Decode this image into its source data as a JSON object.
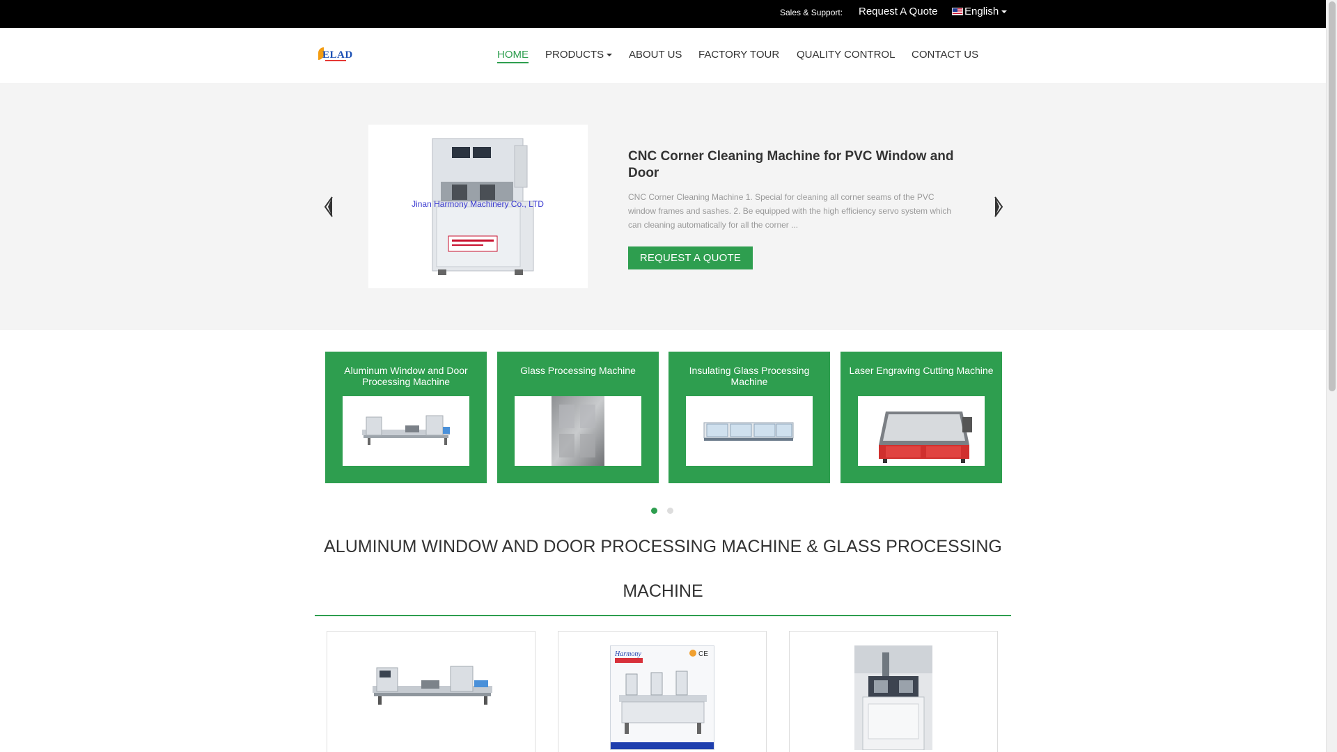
{
  "topbar": {
    "support_label": "Sales & Support:",
    "request_quote_label": "Request A Quote",
    "language_label": "English"
  },
  "header": {
    "logo_text": "ELAD",
    "nav": [
      {
        "label": "HOME",
        "active": true
      },
      {
        "label": "PRODUCTS",
        "has_dropdown": true
      },
      {
        "label": "ABOUT US"
      },
      {
        "label": "FACTORY TOUR"
      },
      {
        "label": "QUALITY CONTROL"
      },
      {
        "label": "CONTACT US"
      }
    ]
  },
  "hero": {
    "image_caption": "Jinan Harmony Machinery Co., LTD",
    "title": "CNC Corner Cleaning Machine for PVC Window and Door",
    "description": "CNC Corner Cleaning Machine 1. Special for cleaning all corner seams of the PVC window frames and sashes. 2. Be equipped with the high efficiency servo system which can cleaning automatically for all the corner ...",
    "button_label": "REQUEST A QUOTE"
  },
  "categories": [
    {
      "title": "Aluminum Window and Door Processing Machine"
    },
    {
      "title": "Glass Processing Machine"
    },
    {
      "title": "Insulating Glass Processing Machine"
    },
    {
      "title": "Laser Engraving Cutting Machine"
    }
  ],
  "carousel": {
    "active_dot": 1,
    "dot_count": 2
  },
  "section": {
    "title": "ALUMINUM WINDOW AND DOOR PROCESSING MACHINE & GLASS PROCESSING MACHINE"
  },
  "colors": {
    "accent_green": "#2e9e4f",
    "topbar_black": "#000000",
    "hero_bg": "#f4f4f4",
    "dot_inactive": "#dddddd"
  }
}
